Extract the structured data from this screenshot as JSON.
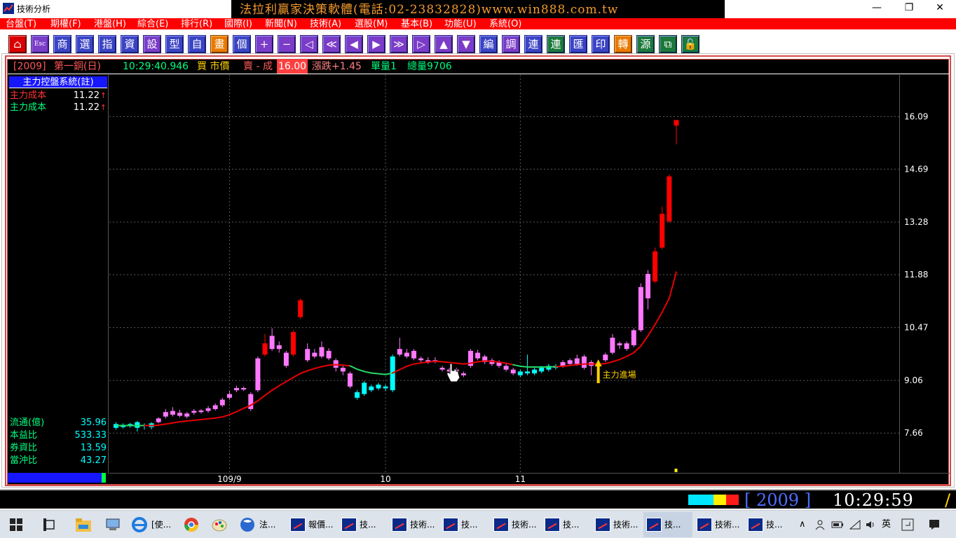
{
  "window": {
    "title": "技術分析",
    "banner": "法拉利贏家決策軟體(電話:02-23832828)www.win888.com.tw",
    "controls": {
      "minimize": "—",
      "restore": "❐",
      "close": "✕"
    }
  },
  "menu": [
    "台盤(T)",
    "期權(F)",
    "港盤(H)",
    "綜合(E)",
    "排行(R)",
    "國際(I)",
    "新聞(N)",
    "技術(A)",
    "選股(M)",
    "基本(B)",
    "功能(U)",
    "系統(O)"
  ],
  "toolbar": [
    {
      "label": "⌂",
      "name": "home-button",
      "color": "red"
    },
    {
      "label": "Esc",
      "name": "escape-button",
      "color": "violet"
    },
    {
      "label": "商",
      "name": "product-button",
      "color": "blue"
    },
    {
      "label": "選",
      "name": "select-button",
      "color": "blue"
    },
    {
      "label": "指",
      "name": "index-button",
      "color": "blue"
    },
    {
      "label": "資",
      "name": "info-button",
      "color": "blue"
    },
    {
      "label": "設",
      "name": "settings-button",
      "color": "violet"
    },
    {
      "label": "型",
      "name": "pattern-button",
      "color": "blue"
    },
    {
      "label": "自",
      "name": "custom-button",
      "color": "blue"
    },
    {
      "label": "畫",
      "name": "draw-button",
      "color": "orange"
    },
    {
      "label": "個",
      "name": "single-button",
      "color": "blue"
    },
    {
      "label": "+",
      "name": "zoom-in-button",
      "color": "violet"
    },
    {
      "label": "−",
      "name": "zoom-out-button",
      "color": "violet"
    },
    {
      "label": "◁",
      "name": "scroll-left-button",
      "color": "violet"
    },
    {
      "label": "≪",
      "name": "fast-left-button",
      "color": "violet"
    },
    {
      "label": "◀",
      "name": "step-left-button",
      "color": "violet"
    },
    {
      "label": "▶",
      "name": "step-right-button",
      "color": "violet"
    },
    {
      "label": "≫",
      "name": "fast-right-button",
      "color": "violet"
    },
    {
      "label": "▷",
      "name": "scroll-right-button",
      "color": "violet"
    },
    {
      "label": "▲",
      "name": "up-button",
      "color": "violet"
    },
    {
      "label": "▼",
      "name": "down-button",
      "color": "violet"
    },
    {
      "label": "編",
      "name": "edit-button",
      "color": "blue"
    },
    {
      "label": "調",
      "name": "adjust-button",
      "color": "violet"
    },
    {
      "label": "連",
      "name": "link-button",
      "color": "blue"
    },
    {
      "label": "連",
      "name": "link2-button",
      "color": "green"
    },
    {
      "label": "匯",
      "name": "export-button",
      "color": "blue"
    },
    {
      "label": "印",
      "name": "print-button",
      "color": "blue"
    },
    {
      "label": "轉",
      "name": "convert-button",
      "color": "orange"
    },
    {
      "label": "源",
      "name": "source-button",
      "color": "green"
    },
    {
      "label": "⧉",
      "name": "window-button",
      "color": "green"
    },
    {
      "label": "🔓",
      "name": "unlock-button",
      "color": "green"
    }
  ],
  "quote": {
    "code": "[2009]",
    "name": "第一銅(日)",
    "time": "10:29:40.946",
    "bid": "買 市價",
    "ask": "賣 - 成",
    "last": "16.00",
    "change": "漲跌+1.45",
    "volume": "單量1",
    "total": "總量9706"
  },
  "panel": {
    "header": "主力控盤系統(註)",
    "rows": [
      {
        "label": "主力成本",
        "value": "11.22",
        "arrow": "↑",
        "color": "#ff3333"
      },
      {
        "label": "主力成本",
        "value": "11.22",
        "arrow": "↑",
        "color": "#00ff7f"
      }
    ],
    "stats": [
      {
        "label": "流通(億)",
        "value": "35.96"
      },
      {
        "label": "本益比",
        "value": "533.33"
      },
      {
        "label": "券資比",
        "value": "13.59"
      },
      {
        "label": "當沖比",
        "value": "43.27"
      }
    ]
  },
  "annotation": {
    "text": "主力進場",
    "color": "#ffd200"
  },
  "colors": {
    "up": "#ff0000",
    "down": "#00ffff",
    "pink": "#ff78ff",
    "ma_red": "#e60000",
    "ma_green": "#22dd66",
    "grid": "#5a5a5a"
  },
  "chart_data": {
    "type": "candlestick",
    "ylim": [
      6.6,
      17.2
    ],
    "y_ticks": [
      "7.66",
      "9.06",
      "10.47",
      "11.88",
      "13.28",
      "14.69",
      "16.09"
    ],
    "y_tick_values": [
      7.66,
      9.06,
      10.47,
      11.88,
      13.28,
      14.69,
      16.09
    ],
    "x_labels": [
      {
        "label": "109/9",
        "index": 16
      },
      {
        "label": "10",
        "index": 38
      },
      {
        "label": "11",
        "index": 57
      }
    ],
    "candles": [
      {
        "o": 7.8,
        "c": 7.9,
        "h": 7.95,
        "l": 7.75,
        "k": "down"
      },
      {
        "o": 7.82,
        "c": 7.88,
        "h": 7.92,
        "l": 7.78,
        "k": "down"
      },
      {
        "o": 7.85,
        "c": 7.9,
        "h": 7.93,
        "l": 7.8,
        "k": "down"
      },
      {
        "o": 7.8,
        "c": 7.95,
        "h": 7.98,
        "l": 7.7,
        "k": "down"
      },
      {
        "o": 7.85,
        "c": 7.88,
        "h": 7.92,
        "l": 7.75,
        "k": "down"
      },
      {
        "o": 7.82,
        "c": 7.92,
        "h": 7.95,
        "l": 7.76,
        "k": "down"
      },
      {
        "o": 7.95,
        "c": 8.05,
        "h": 8.08,
        "l": 7.92,
        "k": "pink"
      },
      {
        "o": 8.1,
        "c": 8.22,
        "h": 8.3,
        "l": 8.05,
        "k": "pink"
      },
      {
        "o": 8.15,
        "c": 8.25,
        "h": 8.35,
        "l": 8.1,
        "k": "pink"
      },
      {
        "o": 8.12,
        "c": 8.2,
        "h": 8.28,
        "l": 8.08,
        "k": "pink"
      },
      {
        "o": 8.1,
        "c": 8.18,
        "h": 8.22,
        "l": 8.05,
        "k": "pink"
      },
      {
        "o": 8.2,
        "c": 8.25,
        "h": 8.3,
        "l": 8.15,
        "k": "pink"
      },
      {
        "o": 8.22,
        "c": 8.26,
        "h": 8.3,
        "l": 8.18,
        "k": "pink"
      },
      {
        "o": 8.25,
        "c": 8.32,
        "h": 8.38,
        "l": 8.2,
        "k": "pink"
      },
      {
        "o": 8.3,
        "c": 8.4,
        "h": 8.45,
        "l": 8.26,
        "k": "pink"
      },
      {
        "o": 8.4,
        "c": 8.55,
        "h": 8.6,
        "l": 8.35,
        "k": "pink"
      },
      {
        "o": 8.6,
        "c": 8.7,
        "h": 8.78,
        "l": 8.55,
        "k": "pink"
      },
      {
        "o": 8.8,
        "c": 8.86,
        "h": 8.92,
        "l": 8.75,
        "k": "pink"
      },
      {
        "o": 8.82,
        "c": 8.86,
        "h": 8.9,
        "l": 8.78,
        "k": "pink"
      },
      {
        "o": 8.3,
        "c": 8.7,
        "h": 8.75,
        "l": 8.25,
        "k": "pink"
      },
      {
        "o": 8.8,
        "c": 9.65,
        "h": 9.7,
        "l": 8.75,
        "k": "pink"
      },
      {
        "o": 10.05,
        "c": 9.75,
        "h": 10.3,
        "l": 9.7,
        "k": "up"
      },
      {
        "o": 9.9,
        "c": 10.25,
        "h": 10.45,
        "l": 9.85,
        "k": "pink"
      },
      {
        "o": 10.0,
        "c": 9.9,
        "h": 10.1,
        "l": 9.8,
        "k": "pink"
      },
      {
        "o": 9.8,
        "c": 9.45,
        "h": 9.85,
        "l": 9.4,
        "k": "pink"
      },
      {
        "o": 10.35,
        "c": 9.75,
        "h": 10.4,
        "l": 9.7,
        "k": "up"
      },
      {
        "o": 11.2,
        "c": 10.75,
        "h": 11.25,
        "l": 10.7,
        "k": "up"
      },
      {
        "o": 9.9,
        "c": 9.6,
        "h": 10.05,
        "l": 9.55,
        "k": "pink"
      },
      {
        "o": 9.8,
        "c": 9.7,
        "h": 9.9,
        "l": 9.65,
        "k": "pink"
      },
      {
        "o": 9.95,
        "c": 9.7,
        "h": 10.1,
        "l": 9.65,
        "k": "pink"
      },
      {
        "o": 9.85,
        "c": 9.65,
        "h": 9.92,
        "l": 9.6,
        "k": "pink"
      },
      {
        "o": 9.6,
        "c": 9.4,
        "h": 9.65,
        "l": 9.3,
        "k": "pink"
      },
      {
        "o": 9.4,
        "c": 9.3,
        "h": 9.45,
        "l": 9.2,
        "k": "pink"
      },
      {
        "o": 9.25,
        "c": 8.9,
        "h": 9.3,
        "l": 8.85,
        "k": "pink"
      },
      {
        "o": 8.75,
        "c": 8.6,
        "h": 8.8,
        "l": 8.55,
        "k": "down"
      },
      {
        "o": 9.0,
        "c": 8.7,
        "h": 9.05,
        "l": 8.65,
        "k": "down"
      },
      {
        "o": 8.9,
        "c": 8.8,
        "h": 8.95,
        "l": 8.75,
        "k": "down"
      },
      {
        "o": 8.95,
        "c": 8.85,
        "h": 9.0,
        "l": 8.8,
        "k": "down"
      },
      {
        "o": 8.9,
        "c": 8.85,
        "h": 8.95,
        "l": 8.78,
        "k": "down"
      },
      {
        "o": 9.7,
        "c": 8.8,
        "h": 9.75,
        "l": 8.75,
        "k": "down"
      },
      {
        "o": 9.75,
        "c": 9.9,
        "h": 10.2,
        "l": 9.7,
        "k": "pink"
      },
      {
        "o": 9.7,
        "c": 9.8,
        "h": 9.9,
        "l": 9.65,
        "k": "pink"
      },
      {
        "o": 9.65,
        "c": 9.85,
        "h": 9.9,
        "l": 9.6,
        "k": "pink"
      },
      {
        "o": 9.6,
        "c": 9.65,
        "h": 9.7,
        "l": 9.55,
        "k": "pink"
      },
      {
        "o": 9.55,
        "c": 9.6,
        "h": 9.68,
        "l": 9.5,
        "k": "pink"
      },
      {
        "o": 9.55,
        "c": 9.6,
        "h": 9.68,
        "l": 9.52,
        "k": "pink"
      },
      {
        "o": 9.4,
        "c": 9.35,
        "h": 9.45,
        "l": 9.3,
        "k": "pink"
      },
      {
        "o": 9.35,
        "c": 9.3,
        "h": 9.4,
        "l": 9.25,
        "k": "pink"
      },
      {
        "o": 9.35,
        "c": 9.3,
        "h": 9.4,
        "l": 9.25,
        "k": "pink"
      },
      {
        "o": 9.25,
        "c": 9.2,
        "h": 9.3,
        "l": 9.15,
        "k": "pink"
      },
      {
        "o": 9.45,
        "c": 9.85,
        "h": 9.9,
        "l": 9.4,
        "k": "pink"
      },
      {
        "o": 9.8,
        "c": 9.65,
        "h": 9.88,
        "l": 9.6,
        "k": "pink"
      },
      {
        "o": 9.7,
        "c": 9.55,
        "h": 9.75,
        "l": 9.5,
        "k": "pink"
      },
      {
        "o": 9.6,
        "c": 9.5,
        "h": 9.65,
        "l": 9.45,
        "k": "pink"
      },
      {
        "o": 9.55,
        "c": 9.45,
        "h": 9.6,
        "l": 9.4,
        "k": "pink"
      },
      {
        "o": 9.45,
        "c": 9.35,
        "h": 9.5,
        "l": 9.3,
        "k": "pink"
      },
      {
        "o": 9.35,
        "c": 9.25,
        "h": 9.4,
        "l": 9.2,
        "k": "pink"
      },
      {
        "o": 9.3,
        "c": 9.2,
        "h": 9.35,
        "l": 9.15,
        "k": "down"
      },
      {
        "o": 9.25,
        "c": 9.3,
        "h": 9.75,
        "l": 9.2,
        "k": "down"
      },
      {
        "o": 9.25,
        "c": 9.35,
        "h": 9.4,
        "l": 9.2,
        "k": "down"
      },
      {
        "o": 9.3,
        "c": 9.4,
        "h": 9.45,
        "l": 9.25,
        "k": "down"
      },
      {
        "o": 9.35,
        "c": 9.45,
        "h": 9.5,
        "l": 9.3,
        "k": "down"
      },
      {
        "o": 9.4,
        "c": 9.45,
        "h": 9.5,
        "l": 9.35,
        "k": "down"
      },
      {
        "o": 9.45,
        "c": 9.55,
        "h": 9.6,
        "l": 9.4,
        "k": "pink"
      },
      {
        "o": 9.5,
        "c": 9.6,
        "h": 9.65,
        "l": 9.45,
        "k": "pink"
      },
      {
        "o": 9.5,
        "c": 9.65,
        "h": 9.75,
        "l": 9.45,
        "k": "pink"
      },
      {
        "o": 9.4,
        "c": 9.7,
        "h": 9.75,
        "l": 9.35,
        "k": "pink"
      },
      {
        "o": 9.45,
        "c": 9.55,
        "h": 9.6,
        "l": 9.2,
        "k": "pink"
      },
      {
        "o": 9.5,
        "c": 9.45,
        "h": 9.55,
        "l": 9.4,
        "k": "pink"
      },
      {
        "o": 9.6,
        "c": 9.75,
        "h": 9.8,
        "l": 9.55,
        "k": "pink"
      },
      {
        "o": 9.8,
        "c": 10.2,
        "h": 10.3,
        "l": 9.75,
        "k": "pink"
      },
      {
        "o": 10.0,
        "c": 10.05,
        "h": 10.1,
        "l": 9.9,
        "k": "pink"
      },
      {
        "o": 9.9,
        "c": 10.05,
        "h": 10.1,
        "l": 9.85,
        "k": "pink"
      },
      {
        "o": 10.0,
        "c": 10.4,
        "h": 10.45,
        "l": 9.95,
        "k": "pink"
      },
      {
        "o": 10.4,
        "c": 11.55,
        "h": 11.65,
        "l": 10.35,
        "k": "pink"
      },
      {
        "o": 11.25,
        "c": 11.9,
        "h": 12.0,
        "l": 10.95,
        "k": "pink"
      },
      {
        "o": 11.7,
        "c": 12.5,
        "h": 12.6,
        "l": 11.65,
        "k": "up"
      },
      {
        "o": 12.6,
        "c": 13.5,
        "h": 13.7,
        "l": 12.55,
        "k": "up"
      },
      {
        "o": 13.3,
        "c": 14.5,
        "h": 14.55,
        "l": 13.25,
        "k": "up"
      },
      {
        "o": 15.85,
        "c": 16.0,
        "h": 16.0,
        "l": 15.35,
        "k": "up"
      }
    ],
    "ma": [
      7.86,
      7.86,
      7.86,
      7.86,
      7.86,
      7.86,
      7.87,
      7.9,
      7.93,
      7.96,
      7.98,
      8.0,
      8.02,
      8.04,
      8.06,
      8.09,
      8.15,
      8.23,
      8.32,
      8.4,
      8.52,
      8.66,
      8.8,
      8.92,
      9.03,
      9.14,
      9.25,
      9.32,
      9.38,
      9.43,
      9.47,
      9.48,
      9.47,
      9.45,
      9.36,
      9.3,
      9.26,
      9.24,
      9.22,
      9.26,
      9.35,
      9.44,
      9.5,
      9.53,
      9.55,
      9.57,
      9.56,
      9.54,
      9.52,
      9.5,
      9.52,
      9.56,
      9.58,
      9.57,
      9.55,
      9.52,
      9.48,
      9.44,
      9.42,
      9.42,
      9.42,
      9.42,
      9.43,
      9.44,
      9.46,
      9.48,
      9.5,
      9.5,
      9.5,
      9.51,
      9.56,
      9.62,
      9.7,
      9.8,
      9.98,
      10.25,
      10.55,
      10.88,
      11.25,
      11.95
    ],
    "ma_green_ranges": [
      [
        0,
        4
      ],
      [
        33,
        39
      ],
      [
        56,
        62
      ]
    ]
  },
  "cursor": {
    "icon": "hand-pointer-icon"
  },
  "status": {
    "squares": [
      "#00e6ff",
      "#00e6ff",
      "#ffee00",
      "#ff1a1a"
    ],
    "code": "[ 2009    ]",
    "time": "10:29:59",
    "slash": "/"
  },
  "taskbar": {
    "tasks": [
      {
        "label": "[使...",
        "name": "task-browser-1",
        "active": false
      },
      {
        "label": "法...",
        "name": "task-app-1",
        "active": false
      },
      {
        "label": "報價...",
        "name": "task-quote",
        "active": false
      },
      {
        "label": "技...",
        "name": "task-tech-1",
        "active": false
      },
      {
        "label": "技術...",
        "name": "task-tech-2",
        "active": false
      },
      {
        "label": "技...",
        "name": "task-tech-3",
        "active": false
      },
      {
        "label": "技術...",
        "name": "task-tech-4",
        "active": false
      },
      {
        "label": "技...",
        "name": "task-tech-5",
        "active": false
      },
      {
        "label": "技術...",
        "name": "task-tech-6",
        "active": false
      },
      {
        "label": "技...",
        "name": "task-tech-7",
        "active": true
      },
      {
        "label": "技術...",
        "name": "task-tech-8",
        "active": false
      },
      {
        "label": "技...",
        "name": "task-tech-9",
        "active": false
      }
    ],
    "ime": "英"
  }
}
